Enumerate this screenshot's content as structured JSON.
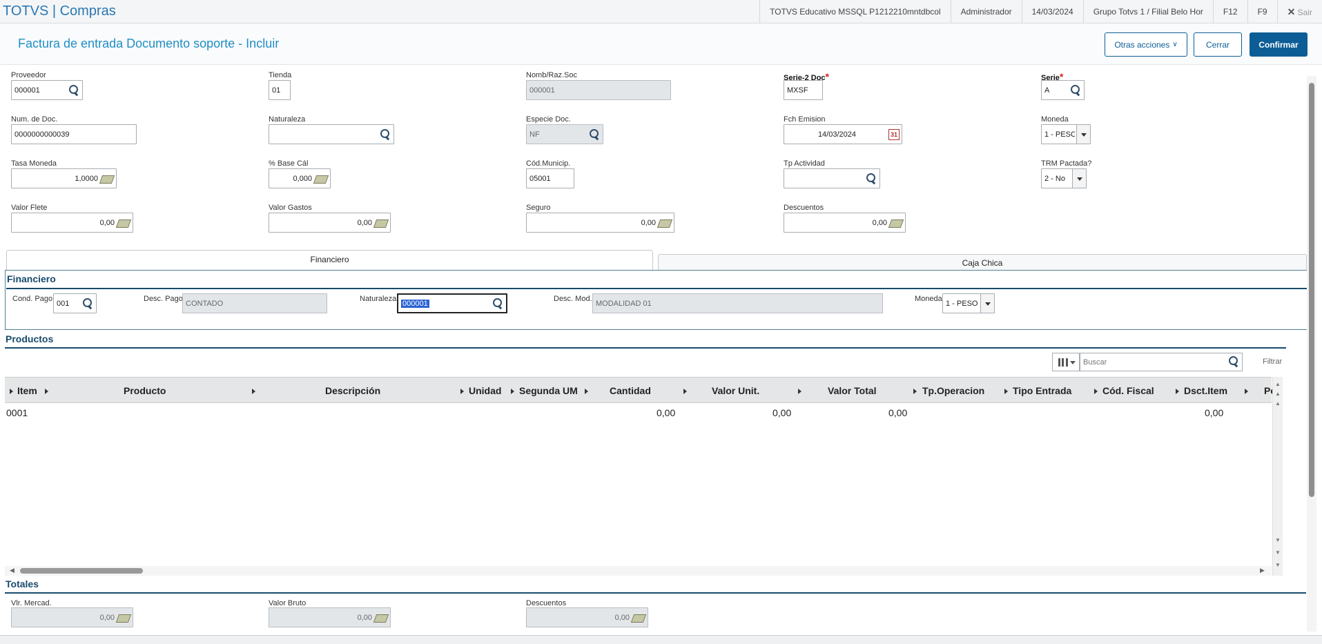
{
  "topbar": {
    "app_title": "TOTVS | Compras",
    "environment": "TOTVS Educativo MSSQL P1212210mntdbcol",
    "user": "Administrador",
    "date": "14/03/2024",
    "branch": "Grupo Totvs 1 / Filial Belo Hor",
    "key_f12": "F12",
    "key_f9": "F9",
    "exit_label": "Sair"
  },
  "header": {
    "title": "Factura de entrada Documento soporte - Incluir",
    "otras_acciones": "Otras acciones",
    "cerrar": "Cerrar",
    "confirmar": "Confirmar"
  },
  "form": {
    "proveedor": {
      "label": "Proveedor",
      "value": "000001"
    },
    "tienda": {
      "label": "Tienda",
      "value": "01"
    },
    "nomb_raz_soc": {
      "label": "Nomb/Raz.Soc",
      "value": "000001"
    },
    "serie2_doc": {
      "label": "Serie-2 Doc",
      "value": "MXSF"
    },
    "serie": {
      "label": "Serie",
      "value": "A"
    },
    "num_doc": {
      "label": "Num. de Doc.",
      "value": "0000000000039"
    },
    "naturaleza": {
      "label": "Naturaleza",
      "value": ""
    },
    "especie_doc": {
      "label": "Especie Doc.",
      "value": "NF"
    },
    "fch_emision": {
      "label": "Fch Emision",
      "value": "14/03/2024"
    },
    "moneda": {
      "label": "Moneda",
      "value": "1 - PESC"
    },
    "tasa_moneda": {
      "label": "Tasa Moneda",
      "value": "1,0000"
    },
    "base_cal": {
      "label": "% Base Cál",
      "value": "0,000"
    },
    "cod_municip": {
      "label": "Cód.Municip.",
      "value": "05001"
    },
    "tp_actividad": {
      "label": "Tp Actividad",
      "value": ""
    },
    "trm_pactada": {
      "label": "TRM Pactada?",
      "value": "2 - No"
    },
    "valor_flete": {
      "label": "Valor Flete",
      "value": "0,00"
    },
    "valor_gastos": {
      "label": "Valor Gastos",
      "value": "0,00"
    },
    "seguro": {
      "label": "Seguro",
      "value": "0,00"
    },
    "descuentos": {
      "label": "Descuentos",
      "value": "0,00"
    }
  },
  "tabs": [
    {
      "label": "Financiero"
    },
    {
      "label": "Caja Chica"
    }
  ],
  "financiero": {
    "title": "Financiero",
    "cond_pago": {
      "label": "Cond. Pago",
      "value": "001"
    },
    "desc_pago": {
      "label": "Desc. Pago",
      "value": "CONTADO"
    },
    "naturaleza": {
      "label": "Naturaleza",
      "value": "000001"
    },
    "desc_mod": {
      "label": "Desc. Mod.",
      "value": "MODALIDAD 01"
    },
    "moneda": {
      "label": "Moneda",
      "value": "1 - PESO"
    }
  },
  "productos": {
    "title": "Productos",
    "search_placeholder": "Buscar",
    "filter_label": "Filtrar",
    "columns": [
      "Item",
      "Producto",
      "Descripción",
      "Unidad",
      "Segunda UM",
      "Cantidad",
      "Valor Unit.",
      "Valor Total",
      "Tp.Operacion",
      "Tipo Entrada",
      "Cód. Fiscal",
      "Dsct.Item",
      "Pe"
    ],
    "rows": [
      {
        "item": "0001",
        "cantidad": "0,00",
        "valor_unit": "0,00",
        "valor_total": "0,00",
        "dsct_item": "0,00"
      }
    ]
  },
  "totales": {
    "title": "Totales",
    "vlr_mercad": {
      "label": "Vlr. Mercad.",
      "value": "0,00"
    },
    "valor_bruto": {
      "label": "Valor Bruto",
      "value": "0,00"
    },
    "descuentos": {
      "label": "Descuentos",
      "value": "0,00"
    }
  },
  "colors": {
    "accent": "#0c5d95",
    "title": "#1f8ec4",
    "section": "#174a6b"
  }
}
